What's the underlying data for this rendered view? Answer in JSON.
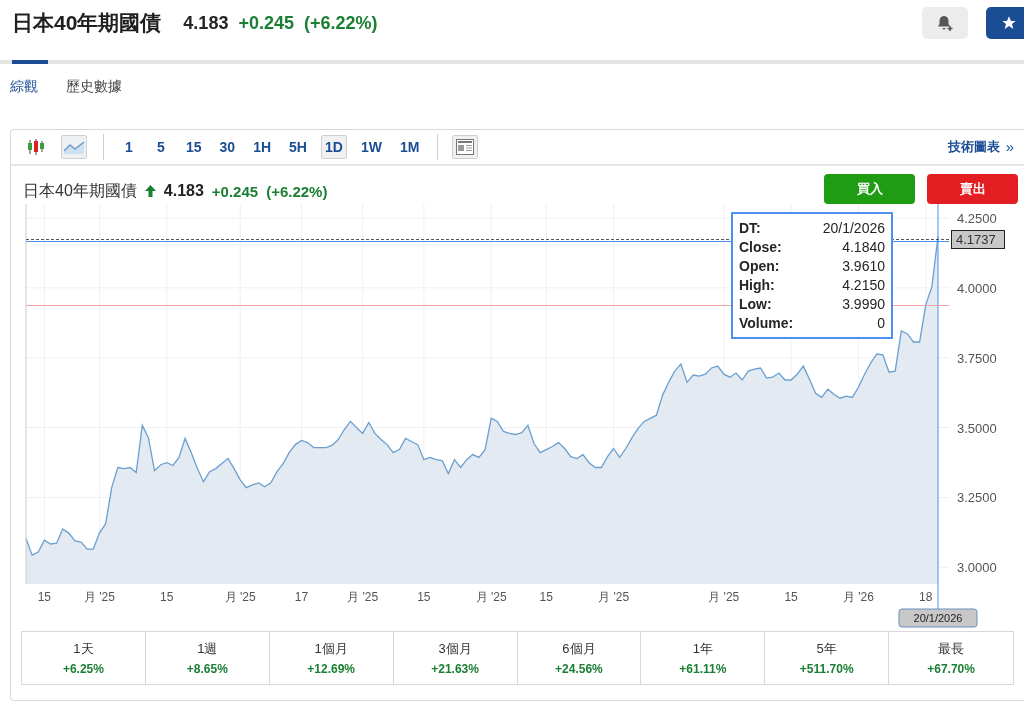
{
  "header": {
    "title": "日本40年期國債",
    "price": "4.183",
    "change": "+0.245",
    "change_pct": "(+6.22%)"
  },
  "header_actions": [
    {
      "kind": "alert"
    },
    {
      "kind": "watchlist"
    }
  ],
  "tabs": [
    {
      "label": "綜觀",
      "selected": true
    },
    {
      "label": "歷史數據",
      "selected": false
    }
  ],
  "toolbar": {
    "chart_types": [
      {
        "kind": "candles",
        "selected": false
      },
      {
        "kind": "line",
        "selected": true
      }
    ],
    "intervals": [
      {
        "label": "1",
        "selected": false
      },
      {
        "label": "5",
        "selected": false
      },
      {
        "label": "15",
        "selected": false
      },
      {
        "label": "30",
        "selected": false
      },
      {
        "label": "1H",
        "selected": false
      },
      {
        "label": "5H",
        "selected": false
      },
      {
        "label": "1D",
        "selected": true
      },
      {
        "label": "1W",
        "selected": false
      },
      {
        "label": "1M",
        "selected": false
      }
    ],
    "link": "技術圖表",
    "link_arrow": "»"
  },
  "chart_header": {
    "title": "日本40年期國債",
    "price": "4.183",
    "change": "+0.245",
    "change_pct": "(+6.22%)"
  },
  "trade_buttons": [
    {
      "kind": "buy",
      "label": "買入"
    },
    {
      "kind": "sell",
      "label": "賣出"
    }
  ],
  "tooltip": [
    {
      "label": "DT:",
      "value": "20/1/2026"
    },
    {
      "label": "Close:",
      "value": "4.1840"
    },
    {
      "label": "Open:",
      "value": "3.9610"
    },
    {
      "label": "High:",
      "value": "4.2150"
    },
    {
      "label": "Low:",
      "value": "3.9990"
    },
    {
      "label": "Volume:",
      "value": "0"
    }
  ],
  "cursor_date": "20/1/2026",
  "price_marker": "4.1737",
  "chart_data": {
    "type": "area",
    "ylim": [
      2.94,
      4.3
    ],
    "grid": true,
    "categories": [
      null,
      null,
      null,
      "15",
      null,
      null,
      null,
      null,
      null,
      null,
      null,
      null,
      "月 '25",
      null,
      null,
      null,
      null,
      null,
      null,
      null,
      null,
      null,
      null,
      "15",
      null,
      null,
      null,
      null,
      null,
      null,
      null,
      null,
      null,
      null,
      null,
      "月 '25",
      null,
      null,
      null,
      null,
      null,
      null,
      null,
      null,
      null,
      "17",
      null,
      null,
      null,
      null,
      null,
      null,
      null,
      null,
      null,
      "月 '25",
      null,
      null,
      null,
      null,
      null,
      null,
      null,
      null,
      null,
      "15",
      null,
      null,
      null,
      null,
      null,
      null,
      null,
      null,
      null,
      null,
      "月 '25",
      null,
      null,
      null,
      null,
      null,
      null,
      null,
      null,
      "15",
      null,
      null,
      null,
      null,
      null,
      null,
      null,
      null,
      null,
      null,
      "月 '25",
      null,
      null,
      null,
      null,
      null,
      null,
      null,
      null,
      null,
      null,
      null,
      null,
      null,
      null,
      null,
      null,
      null,
      "月 '25",
      null,
      null,
      null,
      null,
      null,
      null,
      null,
      null,
      null,
      null,
      "15",
      null,
      null,
      null,
      null,
      null,
      null,
      null,
      null,
      null,
      null,
      "月 '26",
      null,
      null,
      null,
      null,
      null,
      null,
      null,
      null,
      null,
      null,
      "18",
      null,
      null
    ],
    "series": [
      {
        "color": "#6a9fd0",
        "values": [
          3.104,
          3.043,
          3.054,
          3.097,
          3.083,
          3.086,
          3.137,
          3.122,
          3.094,
          3.09,
          3.065,
          3.065,
          3.122,
          3.155,
          3.285,
          3.357,
          3.353,
          3.357,
          3.339,
          3.508,
          3.464,
          3.346,
          3.367,
          3.374,
          3.364,
          3.393,
          3.461,
          3.41,
          3.353,
          3.306,
          3.342,
          3.353,
          3.371,
          3.389,
          3.353,
          3.313,
          3.285,
          3.295,
          3.302,
          3.288,
          3.302,
          3.342,
          3.371,
          3.41,
          3.439,
          3.454,
          3.446,
          3.428,
          3.428,
          3.428,
          3.436,
          3.457,
          3.493,
          3.522,
          3.5,
          3.479,
          3.518,
          3.479,
          3.457,
          3.439,
          3.41,
          3.421,
          3.461,
          3.45,
          3.439,
          3.385,
          3.393,
          3.385,
          3.382,
          3.335,
          3.385,
          3.357,
          3.385,
          3.403,
          3.393,
          3.421,
          3.533,
          3.522,
          3.486,
          3.479,
          3.475,
          3.482,
          3.508,
          3.443,
          3.41,
          3.421,
          3.432,
          3.446,
          3.425,
          3.396,
          3.389,
          3.403,
          3.374,
          3.357,
          3.357,
          3.396,
          3.425,
          3.393,
          3.425,
          3.464,
          3.497,
          3.522,
          3.533,
          3.544,
          3.616,
          3.662,
          3.702,
          3.727,
          3.662,
          3.688,
          3.684,
          3.691,
          3.713,
          3.72,
          3.691,
          3.68,
          3.695,
          3.67,
          3.702,
          3.709,
          3.713,
          3.677,
          3.68,
          3.695,
          3.67,
          3.67,
          3.691,
          3.72,
          3.673,
          3.623,
          3.608,
          3.637,
          3.619,
          3.605,
          3.612,
          3.608,
          3.644,
          3.691,
          3.731,
          3.763,
          3.76,
          3.698,
          3.702,
          3.846,
          3.835,
          3.806,
          3.806,
          3.94,
          4.004,
          4.184
        ]
      }
    ],
    "yticks": [
      {
        "value": 3.0,
        "label": "3.0000"
      },
      {
        "value": 3.25,
        "label": "3.2500"
      },
      {
        "value": 3.5,
        "label": "3.5000"
      },
      {
        "value": 3.75,
        "label": "3.7500"
      },
      {
        "value": 4.0,
        "label": "4.0000"
      },
      {
        "value": 4.25,
        "label": "4.2500"
      }
    ]
  },
  "performance": [
    {
      "period": "1天",
      "change": "+6.25%"
    },
    {
      "period": "1週",
      "change": "+8.65%"
    },
    {
      "period": "1個月",
      "change": "+12.69%"
    },
    {
      "period": "3個月",
      "change": "+21.63%"
    },
    {
      "period": "6個月",
      "change": "+24.56%"
    },
    {
      "period": "1年",
      "change": "+61.11%"
    },
    {
      "period": "5年",
      "change": "+511.70%"
    },
    {
      "period": "最長",
      "change": "+67.70%"
    }
  ]
}
